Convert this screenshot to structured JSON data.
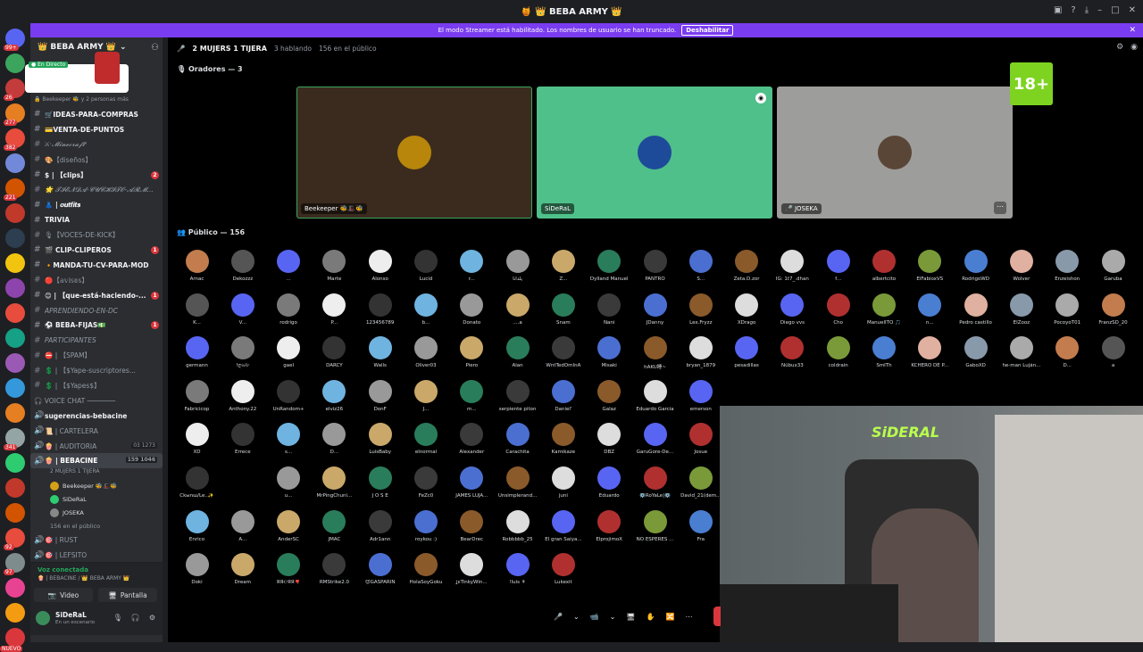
{
  "window": {
    "title": "🍯 👑 BEBA ARMY 👑"
  },
  "banner": {
    "text": "El modo Streamer está habilitado. Los nombres de usuario se han truncado.",
    "button": "Deshabilitar",
    "close": "✕"
  },
  "server": {
    "name": "👑 BEBA ARMY 👑",
    "live_label": "● En Directo",
    "live_sub": "🔒 Beekeeper 🐝 y 2 personas más"
  },
  "servers": [
    {
      "color": "#5865f2",
      "badge": "99+"
    },
    {
      "color": "#3ba55d",
      "badge": ""
    },
    {
      "color": "#c43b3b",
      "badge": "26"
    },
    {
      "color": "#e67e22",
      "badge": "277"
    },
    {
      "color": "#e74c3c",
      "badge": "382"
    },
    {
      "color": "#7289da",
      "badge": ""
    },
    {
      "color": "#d35400",
      "badge": "221"
    },
    {
      "color": "#c0392b",
      "badge": ""
    },
    {
      "color": "#2c3e50",
      "badge": ""
    },
    {
      "color": "#f1c40f",
      "badge": ""
    },
    {
      "color": "#8e44ad",
      "badge": ""
    },
    {
      "color": "#e74c3c",
      "badge": ""
    },
    {
      "color": "#16a085",
      "badge": ""
    },
    {
      "color": "#9b59b6",
      "badge": ""
    },
    {
      "color": "#3498db",
      "badge": ""
    },
    {
      "color": "#e67e22",
      "badge": ""
    },
    {
      "color": "#95a5a6",
      "badge": "341"
    },
    {
      "color": "#2ecc71",
      "badge": ""
    },
    {
      "color": "#c0392b",
      "badge": ""
    },
    {
      "color": "#d35400",
      "badge": ""
    },
    {
      "color": "#e74c3c",
      "badge": "92"
    },
    {
      "color": "#7f8c8d",
      "badge": "97"
    },
    {
      "color": "#e84393",
      "badge": ""
    },
    {
      "color": "#f39c12",
      "badge": ""
    }
  ],
  "nuevo": "NUEVO",
  "channels": [
    {
      "icon": "#",
      "label": "🛒IDEAS-PARA-COMPRAS",
      "bold": true,
      "it": false,
      "n": ""
    },
    {
      "icon": "#",
      "label": "💳VENTA-DE-PUNTOS",
      "bold": true,
      "it": false,
      "n": ""
    },
    {
      "icon": "#",
      "label": "⚔·𝓜𝓲𝓷𝓮𝓬𝓻𝓪𝓯𝓽·",
      "bold": false,
      "it": true,
      "n": ""
    },
    {
      "icon": "#",
      "label": "🎨【diseños】",
      "bold": false,
      "it": false,
      "n": ""
    },
    {
      "icon": "#",
      "label": "$ | 【clips】",
      "bold": true,
      "it": false,
      "n": "2"
    },
    {
      "icon": "#",
      "label": "🌟 𝓣𝓘𝓔𝓝𝓓𝓐-𝓒𝓤𝓒𝓗𝓘𝓣𝓞-𝓐𝓡𝓜...",
      "bold": false,
      "it": true,
      "n": ""
    },
    {
      "icon": "#",
      "label": "👗 | 𝒐𝒖𝒕𝒇𝒊𝒕𝒔",
      "bold": true,
      "it": false,
      "n": ""
    },
    {
      "icon": "#",
      "label": "TRIVIA",
      "bold": true,
      "it": false,
      "n": ""
    },
    {
      "icon": "#",
      "label": "🎙【VOCES-DE-KICK】",
      "bold": false,
      "it": false,
      "n": ""
    },
    {
      "icon": "#",
      "label": "🎬 CLIP-CLIPEROS",
      "bold": true,
      "it": false,
      "n": "1"
    },
    {
      "icon": "#",
      "label": "🔸MANDA-TU-CV-PARA-MOD",
      "bold": true,
      "it": false,
      "n": ""
    },
    {
      "icon": "#",
      "label": "🔴【𝕒𝕧𝕚𝕤𝕠𝕤】",
      "bold": false,
      "it": false,
      "n": ""
    },
    {
      "icon": "#",
      "label": "😊 | 【que-está-haciendo-...",
      "bold": true,
      "it": false,
      "n": "1"
    },
    {
      "icon": "#",
      "label": "APRENDIENDO-EN-DC",
      "bold": false,
      "it": true,
      "n": ""
    },
    {
      "icon": "#",
      "label": "⚽ BEBA-FIJAS💵",
      "bold": true,
      "it": false,
      "n": "1"
    },
    {
      "icon": "#",
      "label": "PARTICIPANTES",
      "bold": false,
      "it": true,
      "n": ""
    },
    {
      "icon": "#",
      "label": "⛔ | 【SPAM】",
      "bold": false,
      "it": false,
      "n": ""
    },
    {
      "icon": "#",
      "label": "💲 | 【$Yape-suscriptores...",
      "bold": false,
      "it": false,
      "n": ""
    },
    {
      "icon": "#",
      "label": "💲 | 【$Yapes$】",
      "bold": false,
      "it": false,
      "n": ""
    }
  ],
  "voice_header": "🎧 VOICE CHAT ───────",
  "voice_channels": [
    {
      "label": "sugerencias-bebacine",
      "bold": true,
      "count": ""
    },
    {
      "label": "📜 | CARTELERA",
      "bold": false,
      "count": ""
    },
    {
      "label": "🍿 | AUDITORIA",
      "bold": false,
      "count": "03 1273"
    },
    {
      "label": "🍿 | BEBACINE",
      "bold": true,
      "count": "159 1046"
    }
  ],
  "bebacine_sub": "2 MUJERS 1 TIJERA",
  "voice_users": [
    {
      "name": "Beekeeper 🐝🎩🐝",
      "color": "#d4a017"
    },
    {
      "name": "SiDeRaL",
      "color": "#2ecc71"
    },
    {
      "name": "JOSEKA",
      "color": "#888"
    }
  ],
  "audience_count_text": "156 en el público",
  "voice_more": [
    {
      "label": "🎯 | RUST"
    },
    {
      "label": "🎯 | LEFSITO"
    }
  ],
  "voicebar": {
    "status": "Voz conectada",
    "sub": "🍿 | BEBACINE / 👑 BEBA ARMY 👑",
    "video": "Video",
    "screen": "Pantalla"
  },
  "user": {
    "name": "SiDeRaL",
    "status": "En un escenario"
  },
  "stage": {
    "title": "2 MUJERS 1 TIJERA",
    "speaking": "3 hablando",
    "audience": "156 en el público",
    "speakers_label": "Oradores — 3",
    "audience_label": "Público — 156",
    "badge": "18+"
  },
  "speakers": [
    {
      "name": "Beekeeper 🐝🎩🐝",
      "bg": "#3b2b1f",
      "ava": "#b8860b",
      "border": "#3ba55d"
    },
    {
      "name": "SiDeRaL",
      "bg": "#4fc089",
      "ava": "#1d4b9a",
      "border": "#4fc089"
    },
    {
      "name": "🎤 JOSEKA",
      "bg": "#9d9d9b",
      "ava": "#5a4637",
      "border": "#9d9d9b"
    }
  ],
  "audience": [
    [
      "Arnac",
      "Dekozzz",
      "...",
      "Marte",
      "Alonso",
      "Lucid",
      "r...",
      "يلدانا",
      "Z...",
      "Dylland Manuel",
      "PANTRO",
      "S...",
      "Zeta.D.zor",
      "IG: 1t7_.dhan",
      "f...",
      "albertcito",
      "ElFabioxVS",
      "RodrigoWD",
      "Wolver",
      "Enzeishon",
      "Garuba"
    ],
    [
      "K...",
      "V...",
      "rodrigo",
      "P...",
      "123456789",
      "b...",
      "Donato",
      "....a",
      "Snam",
      "Nani",
      "JDanny",
      "Lex.Fryzz",
      "XDrago",
      "Diego vvs",
      "Cho",
      "ManuelITO 🎵",
      "n...",
      "Pedro castillo",
      "EIZooz",
      "PocoyoT01",
      "FranzSD_20"
    ],
    [
      "germann",
      "!ღ৯ⅰ৮",
      "gael",
      "DARCY",
      "Walls",
      "Oliver03",
      "Piero",
      "Alan",
      "WntTedOmInA",
      "Misaki",
      "hAKU睡~",
      "bryan_1879",
      "pesadillas",
      "Nübux33",
      "coldrain",
      "SmITh",
      "KCHERO DE P...",
      "GaboXD",
      "he-man Luján...",
      "D...",
      "a"
    ],
    [
      "Fabricicop",
      "Anthony.22",
      "UnRandom+",
      "elviz26",
      "DonF",
      "J...",
      "m...",
      "serpiente piton",
      "Daniel'",
      "Galaz",
      "Eduardo García",
      "emerson",
      "",
      "",
      "",
      "",
      "",
      "",
      "",
      "",
      ""
    ],
    [
      "XD",
      "Errece",
      "s...",
      "D...",
      "LuisBaby",
      "elnormal",
      "Alexander",
      "Carachita",
      "Kamikaze",
      "DBZ",
      "GaruGore-De...",
      "Josue",
      "",
      "",
      "",
      "",
      "",
      "",
      "",
      "",
      ""
    ],
    [
      "Ckыnш/Le..✨",
      "",
      "u...",
      "MrPingChuni...",
      "J O S E",
      "FeZc0",
      "JAMES LUJA...",
      "Unsimplerand...",
      "juni",
      "Eduardo",
      "⚙️RoYaLe|⚙️",
      "David_21(dem...",
      "",
      "",
      "",
      "",
      "",
      "",
      "",
      "",
      ""
    ],
    [
      "Enrico",
      "A...",
      "AnderSC",
      "JMAC",
      "Adr1ann",
      "roykou :)",
      "BearDrec",
      "Robbbbb_25",
      "El gran Saiya...",
      "ElprojimoX",
      "NO ESPERES ...",
      "Fra",
      "",
      "",
      "",
      "",
      "",
      "",
      "",
      "",
      ""
    ],
    [
      "Doki",
      "Dream",
      "ЯЯ℮ЯЯ🎈",
      "RMStrike2.0",
      "😈GASPARIN",
      "HolaSoyGoku",
      "ʝєTinkyWin...",
      "!luis ⚘",
      "Lukexit",
      "",
      "",
      "",
      "",
      "",
      "",
      "",
      "",
      "",
      "",
      "",
      ""
    ]
  ],
  "audience_colors": [
    "#c27c4e",
    "#555",
    "#5865f2",
    "#7a7a7a",
    "#eee",
    "#333",
    "#6fb3e0",
    "#999",
    "#c9a86a",
    "#2a7d5b",
    "#3a3a3a",
    "#4b6fd1",
    "#8a5a2b",
    "#ddd",
    "#5865f2",
    "#b03030",
    "#7a9a3a",
    "#4a7ed1",
    "#e0b0a0",
    "#8899aa",
    "#aaa"
  ],
  "cam": {
    "logo": "SiDERAL"
  },
  "toolbar": [
    "🎤",
    "⌄",
    "📹",
    "⌄",
    "🖥",
    "✋",
    "🔀",
    "⋯"
  ]
}
